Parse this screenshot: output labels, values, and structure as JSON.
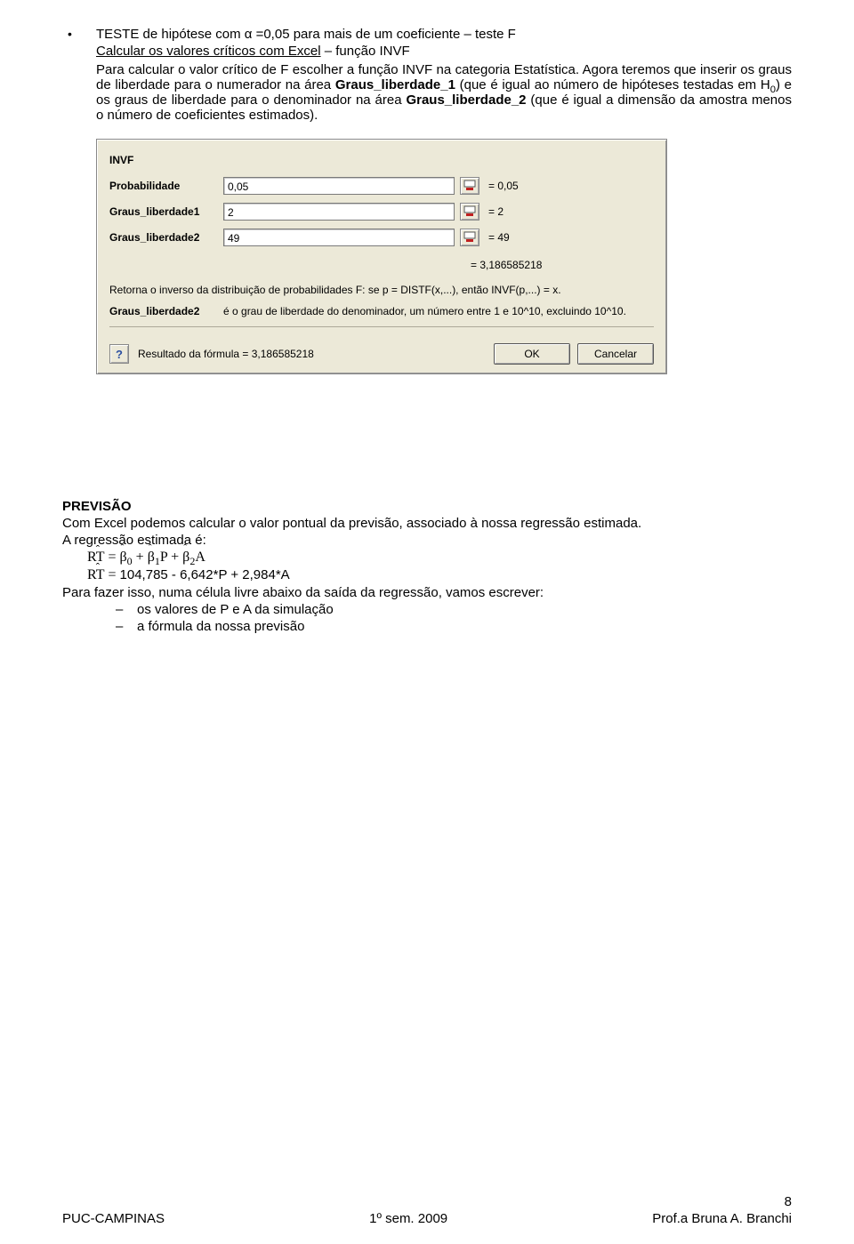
{
  "bullet1": {
    "title": "TESTE de hipótese com α =0,05 para mais de um coeficiente – teste F",
    "line2_a": "Calcular os valores críticos com Excel",
    "line2_b": " – função INVF",
    "line3": "Para calcular o valor crítico de F escolher a função INVF na categoria Estatística. Agora teremos que inserir os graus de liberdade para o numerador na área ",
    "line3b_bold": "Graus_liberdade_1",
    "line3c": " (que é igual ao número de hipóteses testadas em H",
    "line3_sub": "0",
    "line3d": ") e os graus de liberdade para o denominador na área ",
    "line3e_bold": "Graus_liberdade_2",
    "line3f": " (que é igual a dimensão da amostra menos o número de coeficientes estimados)."
  },
  "dialog": {
    "title": "INVF",
    "rows": {
      "prob": {
        "label": "Probabilidade",
        "value": "0,05",
        "eq": "= 0,05"
      },
      "gl1": {
        "label": "Graus_liberdade1",
        "value": "2",
        "eq": "= 2"
      },
      "gl2": {
        "label": "Graus_liberdade2",
        "value": "49",
        "eq": "= 49"
      }
    },
    "result_eq": "= 3,186585218",
    "desc": "Retorna o inverso da distribuição de probabilidades F: se p = DISTF(x,...), então INVF(p,...) = x.",
    "field_label": "Graus_liberdade2",
    "field_desc": "é o grau de liberdade do denominador, um número entre 1 e 10^10, excluindo 10^10.",
    "help": "?",
    "formula_result": "Resultado da fórmula = 3,186585218",
    "ok": "OK",
    "cancel": "Cancelar"
  },
  "previsao": {
    "heading": "PREVISÃO",
    "p1": "Com Excel podemos calcular o valor pontual da previsão, associado à nossa regressão estimada.",
    "p2": "A regressão estimada é:",
    "formula1": "RT̂ = β̂₀ + β̂₁P + β̂₂A",
    "formula2_a": "RT̂ = ",
    "formula2_b": "104,785 - 6,642*P + 2,984*A",
    "p3": "Para fazer isso, numa célula livre abaixo da saída da regressão, vamos escrever:",
    "li1": "os valores de P e A da simulação",
    "li2": "a fórmula da nossa previsão"
  },
  "footer": {
    "pagenum": "8",
    "left": "PUC-CAMPINAS",
    "center": "1º sem. 2009",
    "right": "Prof.a Bruna A. Branchi"
  }
}
